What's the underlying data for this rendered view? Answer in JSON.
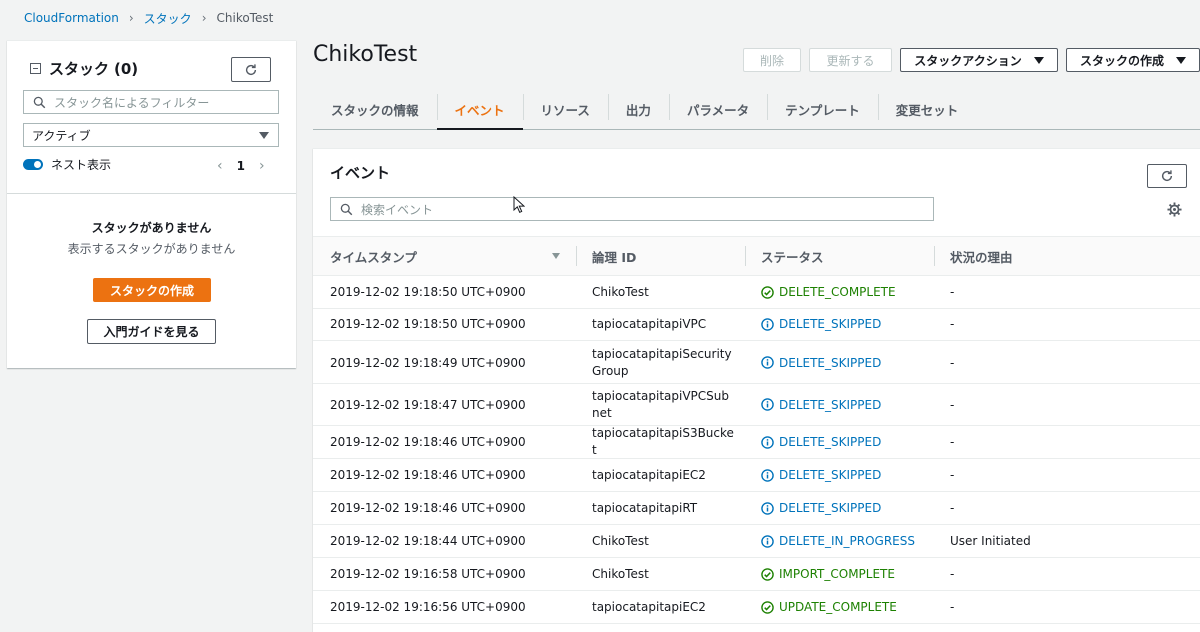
{
  "breadcrumb": [
    "CloudFormation",
    "スタック",
    "ChikoTest"
  ],
  "sidebar": {
    "title": "スタック",
    "count": "(0)",
    "search_placeholder": "スタック名によるフィルター",
    "status_filter": "アクティブ",
    "nested_toggle_label": "ネスト表示",
    "page_number": "1",
    "empty_title": "スタックがありません",
    "empty_subtitle": "表示するスタックがありません",
    "create_button": "スタックの作成",
    "guide_button": "入門ガイドを見る"
  },
  "header": {
    "title": "ChikoTest",
    "delete_button": "削除",
    "update_button": "更新する",
    "stack_actions_button": "スタックアクション",
    "create_stack_button": "スタックの作成"
  },
  "tabs": [
    {
      "label": "スタックの情報",
      "active": false
    },
    {
      "label": "イベント",
      "active": true
    },
    {
      "label": "リソース",
      "active": false
    },
    {
      "label": "出力",
      "active": false
    },
    {
      "label": "パラメータ",
      "active": false
    },
    {
      "label": "テンプレート",
      "active": false
    },
    {
      "label": "変更セット",
      "active": false
    }
  ],
  "events": {
    "title": "イベント",
    "search_placeholder": "検索イベント",
    "columns": [
      "タイムスタンプ",
      "論理 ID",
      "ステータス",
      "状況の理由"
    ],
    "rows": [
      {
        "timestamp": "2019-12-02 19:18:50 UTC+0900",
        "logical_id": "ChikoTest",
        "status": "DELETE_COMPLETE",
        "status_type": "success",
        "reason": "-"
      },
      {
        "timestamp": "2019-12-02 19:18:50 UTC+0900",
        "logical_id": "tapiocatapitapiVPC",
        "status": "DELETE_SKIPPED",
        "status_type": "info",
        "reason": "-"
      },
      {
        "timestamp": "2019-12-02 19:18:49 UTC+0900",
        "logical_id": "tapiocatapitapiSecurityGroup",
        "status": "DELETE_SKIPPED",
        "status_type": "info",
        "reason": "-"
      },
      {
        "timestamp": "2019-12-02 19:18:47 UTC+0900",
        "logical_id": "tapiocatapitapiVPCSubnet",
        "status": "DELETE_SKIPPED",
        "status_type": "info",
        "reason": "-"
      },
      {
        "timestamp": "2019-12-02 19:18:46 UTC+0900",
        "logical_id": "tapiocatapitapiS3Bucket",
        "status": "DELETE_SKIPPED",
        "status_type": "info",
        "reason": "-"
      },
      {
        "timestamp": "2019-12-02 19:18:46 UTC+0900",
        "logical_id": "tapiocatapitapiEC2",
        "status": "DELETE_SKIPPED",
        "status_type": "info",
        "reason": "-"
      },
      {
        "timestamp": "2019-12-02 19:18:46 UTC+0900",
        "logical_id": "tapiocatapitapiRT",
        "status": "DELETE_SKIPPED",
        "status_type": "info",
        "reason": "-"
      },
      {
        "timestamp": "2019-12-02 19:18:44 UTC+0900",
        "logical_id": "ChikoTest",
        "status": "DELETE_IN_PROGRESS",
        "status_type": "info",
        "reason": "User Initiated"
      },
      {
        "timestamp": "2019-12-02 19:16:58 UTC+0900",
        "logical_id": "ChikoTest",
        "status": "IMPORT_COMPLETE",
        "status_type": "success",
        "reason": "-"
      },
      {
        "timestamp": "2019-12-02 19:16:56 UTC+0900",
        "logical_id": "tapiocatapitapiEC2",
        "status": "UPDATE_COMPLETE",
        "status_type": "success",
        "reason": "-"
      }
    ]
  },
  "colors": {
    "accent": "#ec7211",
    "link": "#0073bb",
    "success": "#1d8102",
    "info": "#0073bb"
  }
}
